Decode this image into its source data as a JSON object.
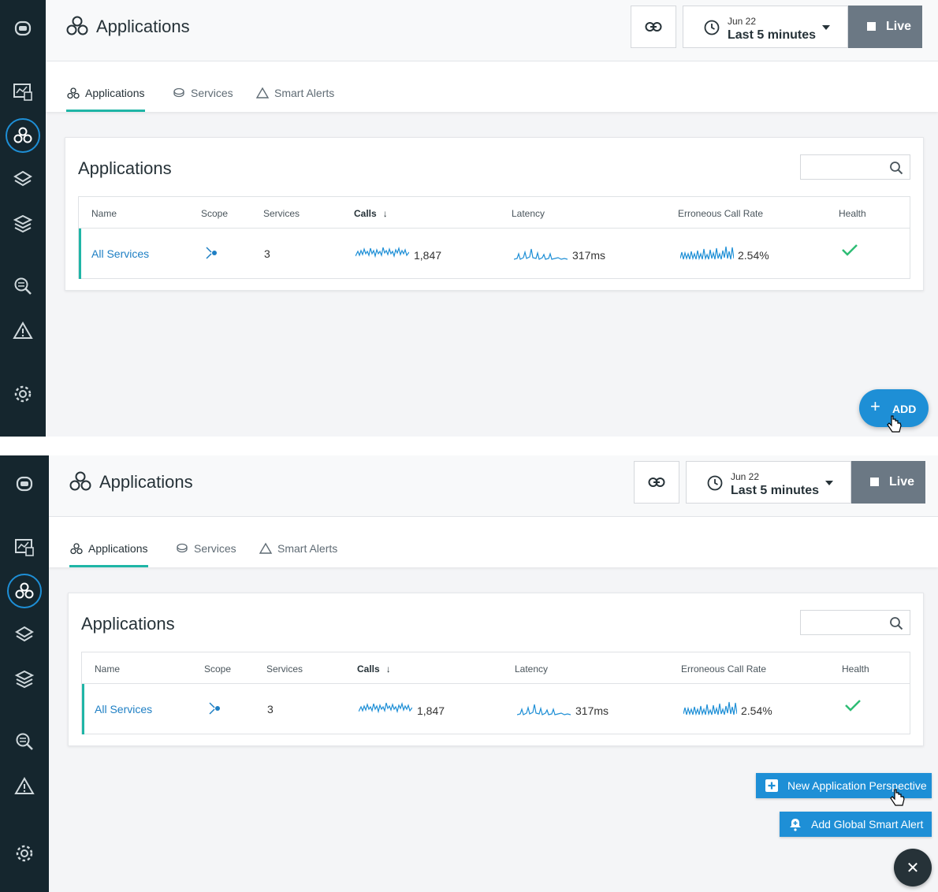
{
  "page": {
    "title": "Applications",
    "time_date": "Jun 22",
    "time_range": "Last 5 minutes",
    "live_label": "Live"
  },
  "tabs": [
    {
      "label": "Applications",
      "active": true
    },
    {
      "label": "Services",
      "active": false
    },
    {
      "label": "Smart Alerts",
      "active": false
    }
  ],
  "card": {
    "title": "Applications",
    "search_placeholder": ""
  },
  "table": {
    "columns": [
      "Name",
      "Scope",
      "Services",
      "Calls",
      "Latency",
      "Erroneous Call Rate",
      "Health"
    ],
    "sorted_column": "Calls",
    "rows": [
      {
        "name": "All Services",
        "services": "3",
        "calls": "1,847",
        "latency": "317ms",
        "error_rate": "2.54%",
        "health": "healthy"
      }
    ]
  },
  "sidebar": {
    "icons": [
      "robot-logo-icon",
      "dashboard-icon",
      "applications-icon",
      "platform-icon",
      "infrastructure-icon",
      "analyze-icon",
      "events-icon",
      "settings-icon"
    ]
  },
  "actions": {
    "add_label": "ADD",
    "new_perspective_label": "New Application Perspective",
    "global_alert_label": "Add Global Smart Alert",
    "close_label": "✕"
  },
  "colors": {
    "sidebar": "#15262e",
    "accent": "#1e8fd6",
    "tab_underline": "#1fb5a6",
    "health_ok": "#2ebd75"
  }
}
